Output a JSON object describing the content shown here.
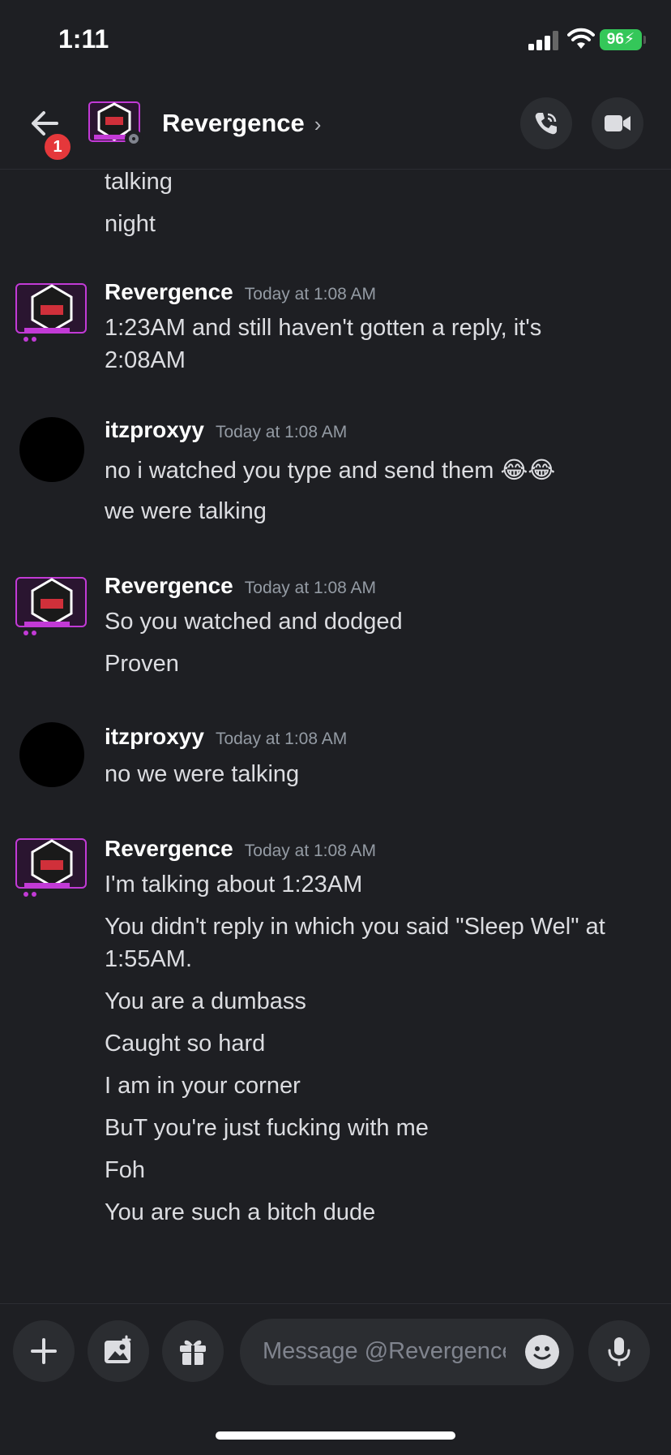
{
  "status_bar": {
    "time": "1:11",
    "battery": "96"
  },
  "header": {
    "title": "Revergence",
    "notification_count": "1"
  },
  "messages": {
    "cont_lines": [
      "talking",
      "night"
    ],
    "g1": {
      "author": "Revergence",
      "timestamp": "Today at 1:08 AM",
      "lines": [
        "1:23AM and still haven't gotten a reply, it's",
        "2:08AM"
      ]
    },
    "g2": {
      "author": "itzproxyy",
      "timestamp": "Today at 1:08 AM",
      "lines": [
        "no i watched you type and send them 😂😂",
        "we were talking"
      ]
    },
    "g3": {
      "author": "Revergence",
      "timestamp": "Today at 1:08 AM",
      "lines": [
        "So you watched and dodged",
        "Proven"
      ]
    },
    "g4": {
      "author": "itzproxyy",
      "timestamp": "Today at 1:08 AM",
      "lines": [
        "no we were talking"
      ]
    },
    "g5": {
      "author": "Revergence",
      "timestamp": "Today at 1:08 AM",
      "lines": [
        "I'm talking about 1:23AM",
        "You didn't reply in which you said \"Sleep Wel\" at",
        "1:55AM.",
        "You are a dumbass",
        "Caught so hard",
        "I am in your corner",
        "BuT you're just fucking with me",
        "Foh",
        "You are such a bitch dude"
      ]
    }
  },
  "composer": {
    "placeholder": "Message @Revergence"
  }
}
